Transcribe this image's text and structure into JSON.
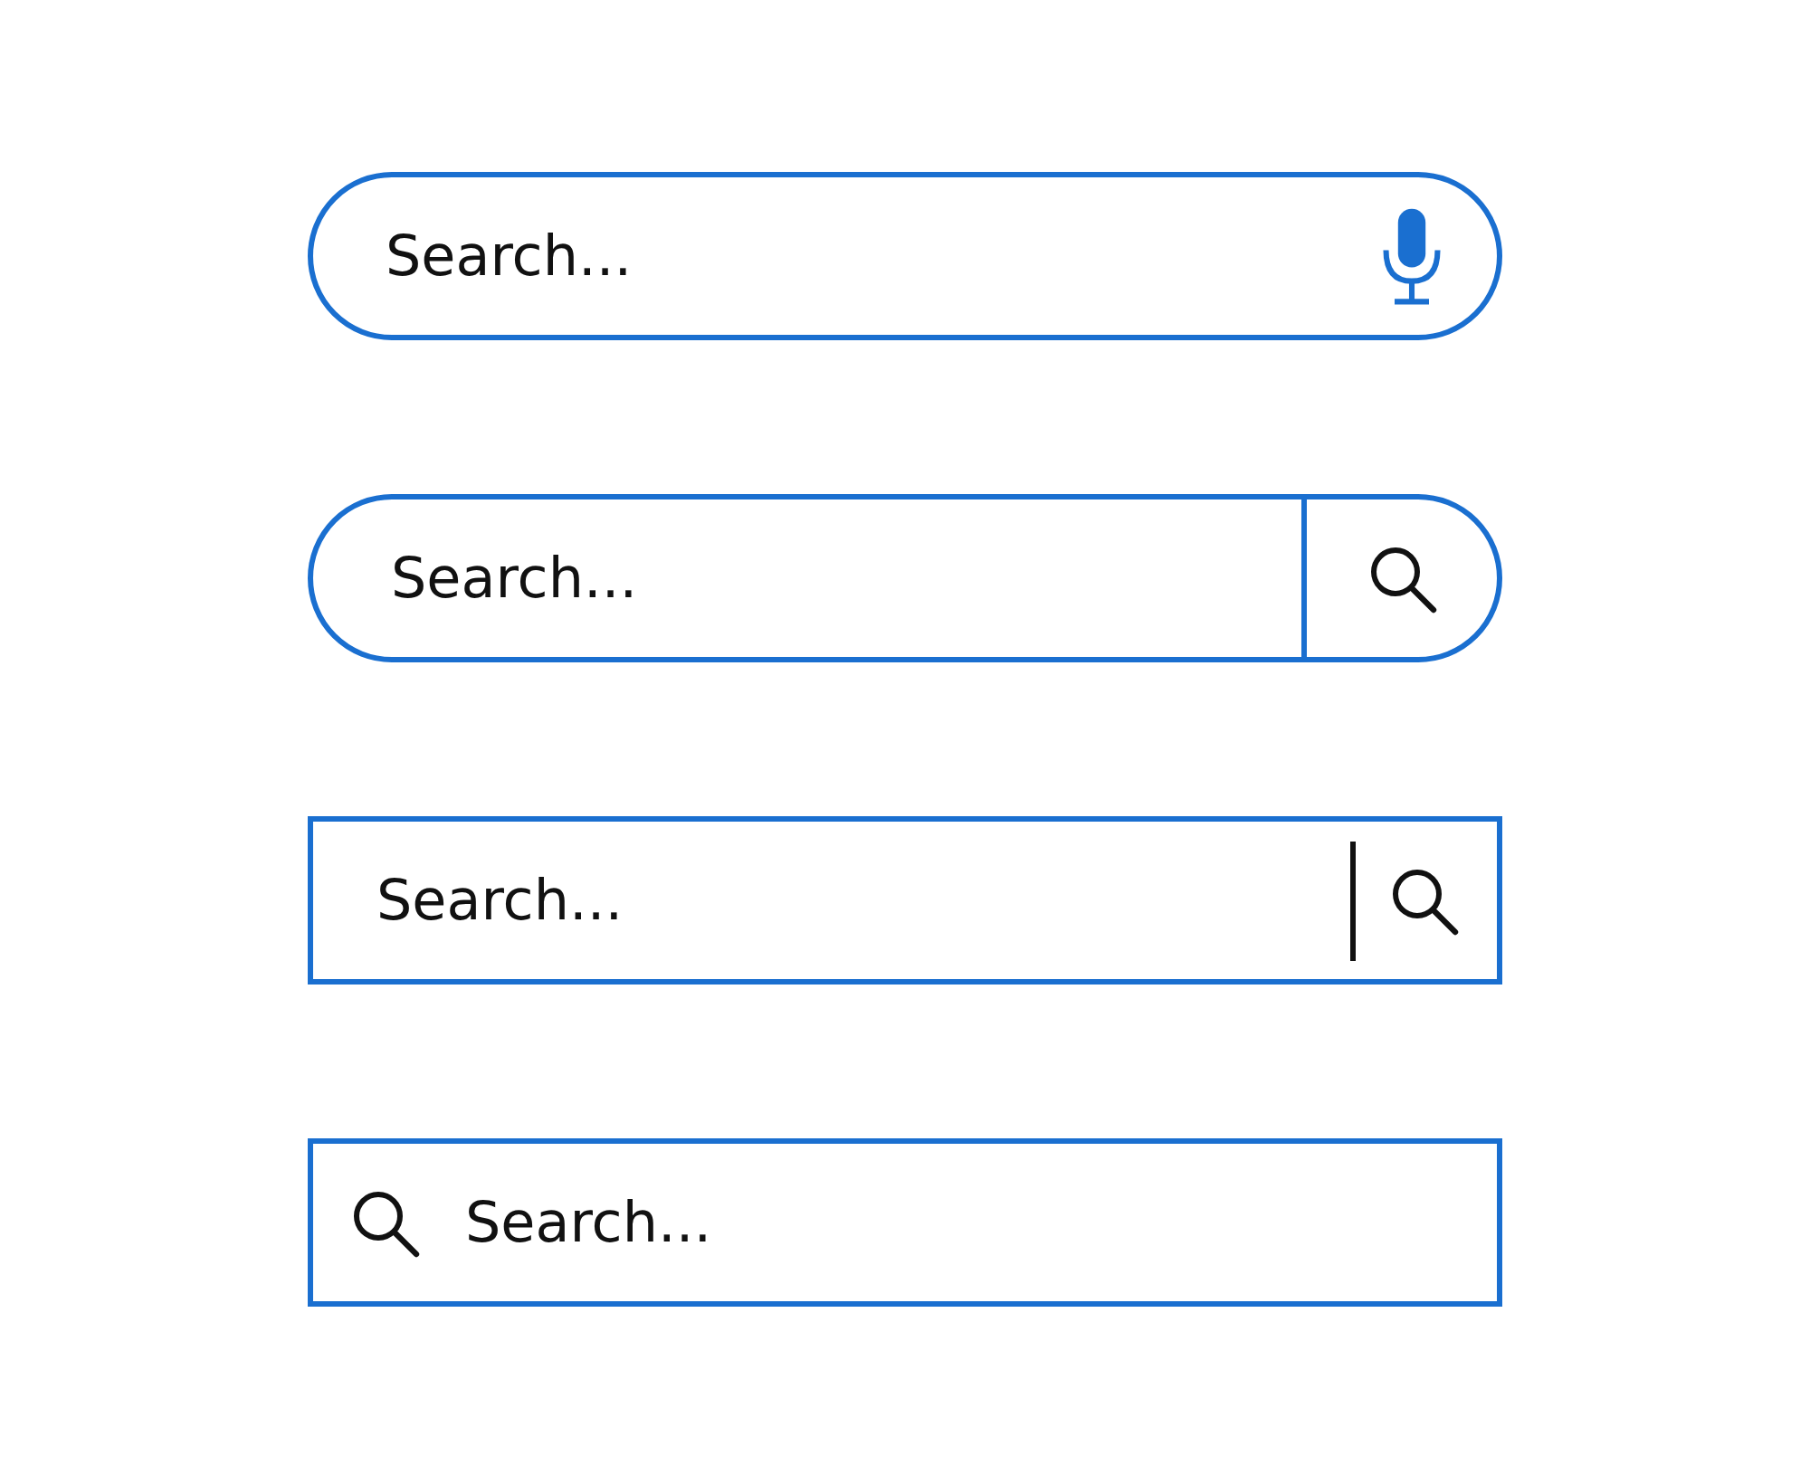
{
  "search_bars": [
    {
      "kind": "pill-mic",
      "placeholder": "Search..."
    },
    {
      "kind": "pill-button",
      "placeholder": "Search..."
    },
    {
      "kind": "box-cursor",
      "placeholder": "Search..."
    },
    {
      "kind": "box-left-icon",
      "placeholder": "Search..."
    }
  ]
}
